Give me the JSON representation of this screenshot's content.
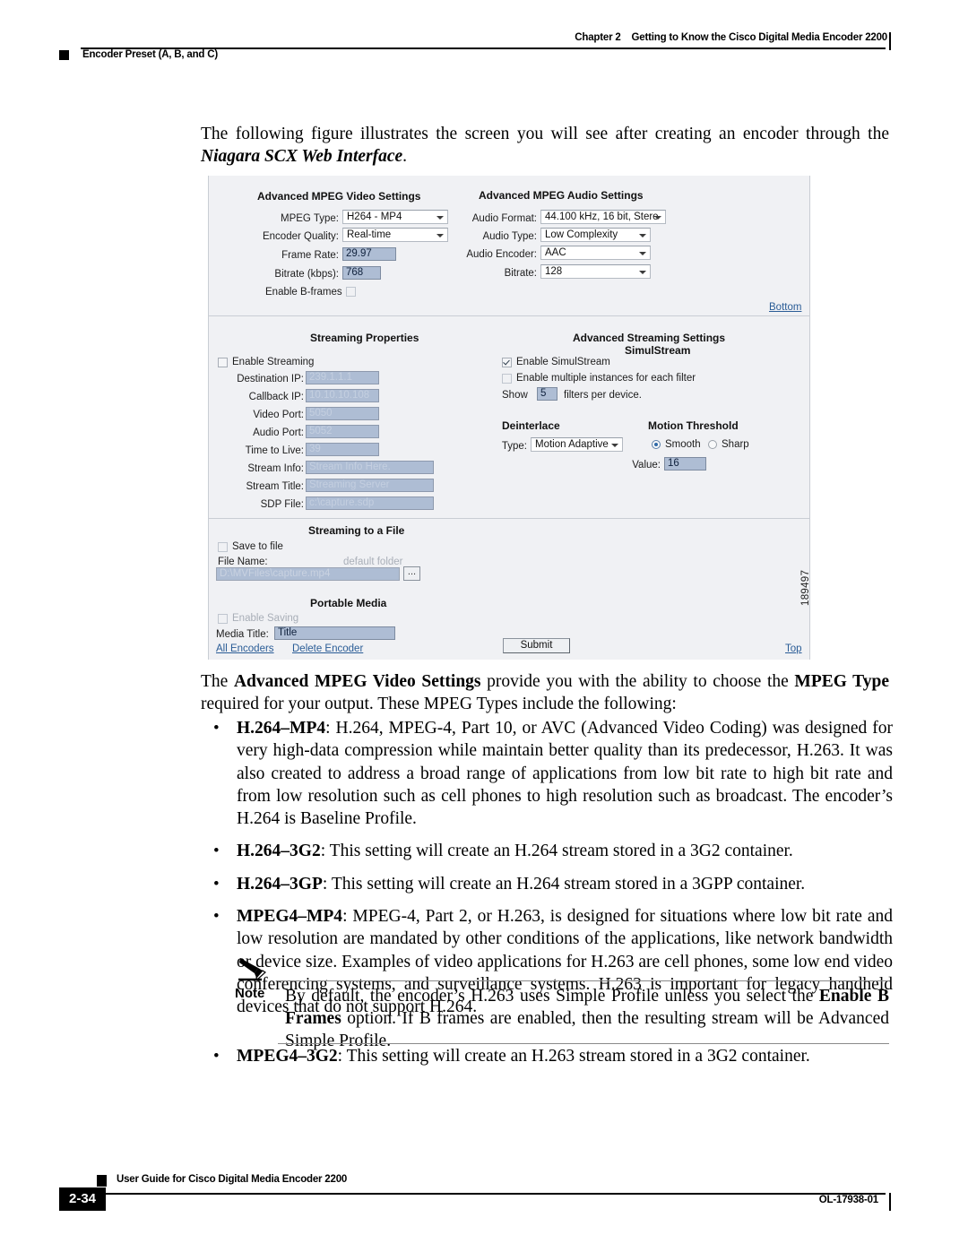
{
  "header": {
    "chapter_number": "Chapter 2",
    "chapter_title": "Getting to Know the Cisco Digital Media Encoder 2200",
    "section_title": "Encoder Preset (A, B, and C)"
  },
  "body": {
    "intro_before": "The following figure illustrates the screen you will see after creating an encoder through the ",
    "intro_italic": "Niagara SCX Web Interface",
    "intro_after": ".",
    "para_after_figure": "The <b>Advanced MPEG Video Settings</b> provide you with the ability to choose the <b>MPEG Type</b> required for your output. These MPEG Types include the following:",
    "bullets": [
      "<b>H.264&#8211;MP4</b>: H.264, MPEG-4, Part 10, or AVC (Advanced Video Coding) was designed for very high-data compression while maintain better quality than its predecessor, H.263. It was also created to address a broad range of applications from low bit rate to high bit rate and from low resolution such as cell phones to high resolution such as broadcast. The encoder&#8217;s H.264 is Baseline Profile.",
      "<b>H.264&#8211;3G2</b>: This setting will create an H.264 stream stored in a 3G2 container.",
      "<b>H.264&#8211;3GP</b>: This setting will create an H.264 stream stored in a 3GPP container.",
      "<b>MPEG4&#8211;MP4</b>: MPEG-4, Part 2, or H.263, is designed for situations where low bit rate and low resolution are mandated by other conditions of the applications, like network bandwidth or device size. Examples of video applications for H.263 are cell phones, some low end video conferencing systems, and surveillance systems. H.263 is important for legacy handheld devices that do not support H.264."
    ],
    "note_label": "Note",
    "note_text": "By default, the encoder&#8217;s H.263 uses Simple Profile unless you select the <b>Enable B Frames</b> option. If B frames are enabled, then the resulting stream will be Advanced Simple Profile.",
    "bullet_last": "<b>MPEG4&#8211;3G2</b>: This setting will create an H.263 stream stored in a 3G2 container."
  },
  "figure": {
    "figure_id": "189497",
    "video_settings": {
      "title": "Advanced MPEG Video Settings",
      "mpeg_type_label": "MPEG Type:",
      "mpeg_type_value": "H264 - MP4",
      "encoder_quality_label": "Encoder Quality:",
      "encoder_quality_value": "Real-time",
      "frame_rate_label": "Frame Rate:",
      "frame_rate_value": "29.97",
      "bitrate_label": "Bitrate (kbps):",
      "bitrate_value": "768",
      "enable_bframes_label": "Enable B-frames"
    },
    "audio_settings": {
      "title": "Advanced MPEG Audio Settings",
      "audio_format_label": "Audio Format:",
      "audio_format_value": "44.100 kHz, 16 bit, Stere",
      "audio_type_label": "Audio Type:",
      "audio_type_value": "Low Complexity",
      "audio_encoder_label": "Audio Encoder:",
      "audio_encoder_value": "AAC",
      "bitrate_label": "Bitrate:",
      "bitrate_value": "128",
      "bottom_link": "Bottom"
    },
    "streaming_properties": {
      "title": "Streaming Properties",
      "enable_streaming_label": "Enable Streaming",
      "destination_ip_label": "Destination IP:",
      "destination_ip_value": "239.1.1.1",
      "callback_ip_label": "Callback IP:",
      "callback_ip_value": "10.10.10.108",
      "video_port_label": "Video Port:",
      "video_port_value": "5050",
      "audio_port_label": "Audio Port:",
      "audio_port_value": "5052",
      "time_to_live_label": "Time to Live:",
      "time_to_live_value": "39",
      "stream_info_label": "Stream Info:",
      "stream_info_value": "Stream Info Here.",
      "stream_title_label": "Stream Title:",
      "stream_title_value": "Streaming Server",
      "sdp_file_label": "SDP File:",
      "sdp_file_value": "c:\\capture.sdp"
    },
    "advanced_streaming": {
      "title": "Advanced Streaming Settings",
      "subtitle": "SimulStream",
      "enable_simulstream_label": "Enable SimulStream",
      "enable_multiple_label": "Enable multiple instances for each filter",
      "show_prefix": "Show",
      "filters_value": "5",
      "show_suffix": "filters per device.",
      "deinterlace_title": "Deinterlace",
      "deinterlace_type_label": "Type:",
      "deinterlace_type_value": "Motion Adaptive",
      "motion_threshold_title": "Motion Threshold",
      "smooth_label": "Smooth",
      "sharp_label": "Sharp",
      "value_label": "Value:",
      "value_value": "16"
    },
    "streaming_to_file": {
      "title": "Streaming to a File",
      "save_to_file_label": "Save to file",
      "file_name_label": "File Name:",
      "default_folder_label": "default folder",
      "file_path_value": "D:\\MVFiles\\capture.mp4",
      "browse_label": "..."
    },
    "portable_media": {
      "title": "Portable Media",
      "enable_saving_label": "Enable Saving",
      "media_title_label": "Media Title:",
      "media_title_value": "Title"
    },
    "actions": {
      "all_encoders_link": "All Encoders",
      "delete_encoder_link": "Delete Encoder",
      "submit_label": "Submit",
      "top_link": "Top"
    }
  },
  "footer": {
    "page_number": "2-34",
    "guide_title": "User Guide for Cisco Digital Media Encoder 2200",
    "doc_id": "OL-17938-01"
  }
}
